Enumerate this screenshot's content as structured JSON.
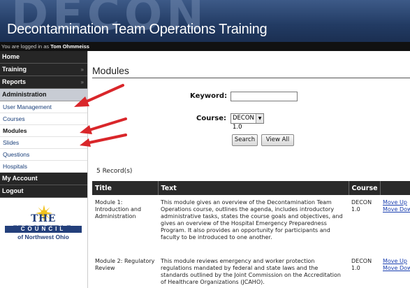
{
  "header": {
    "bg_word": "DECON",
    "title": "Decontamination Team Operations Training"
  },
  "loginbar": {
    "prefix": "You are logged in as",
    "user": "Tom Ohmmeiss"
  },
  "nav": {
    "home": "Home",
    "training": "Training",
    "reports": "Reports",
    "administration": "Administration",
    "admin_items": [
      "User Management",
      "Courses",
      "Modules",
      "Slides",
      "Questions",
      "Hospitals"
    ],
    "my_account": "My Account",
    "logout": "Logout",
    "chevron": "»"
  },
  "logo": {
    "line1": "THE HOSPITAL",
    "line2": "COUNCIL",
    "line3": "of Northwest Ohio"
  },
  "page": {
    "title": "Modules",
    "keyword_label": "Keyword:",
    "keyword_value": "",
    "course_label": "Course:",
    "course_value": "DECON 1.0",
    "search_btn": "Search",
    "viewall_btn": "View All",
    "records": "5 Record(s)"
  },
  "table": {
    "headers": [
      "Title",
      "Text",
      "Course",
      ""
    ],
    "rows": [
      {
        "title": "Module 1: Introduction and Administration",
        "text": "This module gives an overview of the Decontamination Team Operations course, outlines the agenda, includes introductory administrative tasks, states the course goals and objectives, and gives an overview of the Hospital Emergency Preparedness Program. It also provides an opportunity for participants and faculty to be introduced to one another.",
        "course": "DECON 1.0",
        "act1": "Move Up",
        "act2": "Move Down"
      },
      {
        "title": "Module 2: Regulatory Review",
        "text": "This module reviews emergency and worker protection regulations mandated by federal and state laws and the standards outlined by the Joint Commission on the Accreditation of Healthcare Organizations (JCAHO).",
        "course": "DECON 1.0",
        "act1": "Move Up",
        "act2": "Move Down"
      }
    ]
  },
  "colors": {
    "header_bg": "#223b63",
    "nav_bg": "#262626",
    "arrow": "#d9262a",
    "link": "#1a3fb0"
  }
}
